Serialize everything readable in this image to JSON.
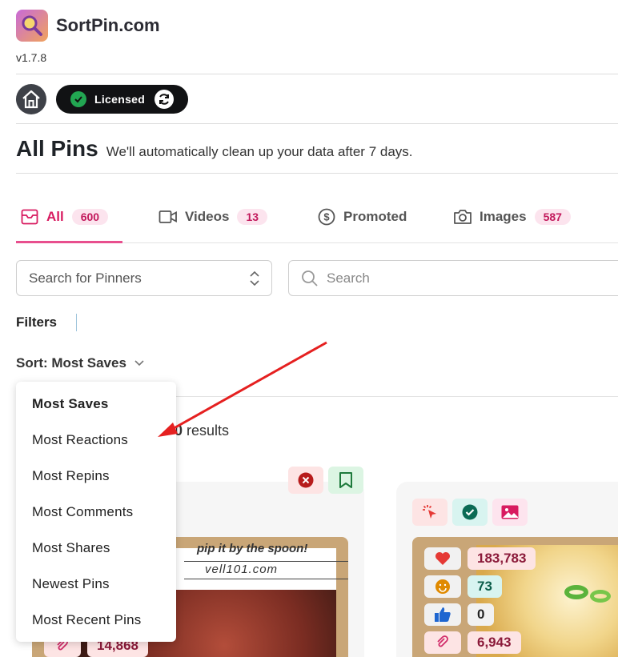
{
  "app": {
    "title": "SortPin.com",
    "version": "v1.7.8"
  },
  "license": {
    "label": "Licensed"
  },
  "page": {
    "title": "All Pins",
    "subtitle": "We'll automatically clean up your data after 7 days."
  },
  "tabs": [
    {
      "label": "All",
      "count": "600",
      "icon": "inbox-icon",
      "active": true
    },
    {
      "label": "Videos",
      "count": "13",
      "icon": "video-camera-icon",
      "active": false
    },
    {
      "label": "Promoted",
      "count": "",
      "icon": "dollar-circle-icon",
      "active": false
    },
    {
      "label": "Images",
      "count": "587",
      "icon": "camera-icon",
      "active": false
    }
  ],
  "pinner_select": {
    "placeholder": "Search for Pinners"
  },
  "search": {
    "placeholder": "Search"
  },
  "filters": {
    "label": "Filters"
  },
  "sort": {
    "label": "Sort: Most Saves",
    "options": [
      "Most Saves",
      "Most Reactions",
      "Most Repins",
      "Most Comments",
      "Most Shares",
      "Newest Pins",
      "Most Recent Pins"
    ],
    "selected": "Most Saves"
  },
  "results": {
    "count_fragment": "0",
    "label": "results"
  },
  "card1": {
    "image_text_top": "pip it by the spoon!",
    "image_text_url": "vell101.com",
    "partial_stat": "14,868"
  },
  "card2": {
    "stats": [
      {
        "icon": "heart-icon",
        "value": "183,783",
        "color": "#e53935",
        "bg": "#fde4e4"
      },
      {
        "icon": "smiley-icon",
        "value": "73",
        "color": "#e08a00",
        "bg": "#d8f4f0"
      },
      {
        "icon": "thumbs-up-icon",
        "value": "0",
        "color": "#1e66d0",
        "bg": "#f1f1f1"
      },
      {
        "icon": "paperclip-icon",
        "value": "6,943",
        "color": "#d12c6a",
        "bg": "#fde4e4"
      }
    ]
  },
  "colors": {
    "accent": "#d81b60",
    "badge_bg": "#fce4ee",
    "annotation_arrow": "#e52020"
  }
}
